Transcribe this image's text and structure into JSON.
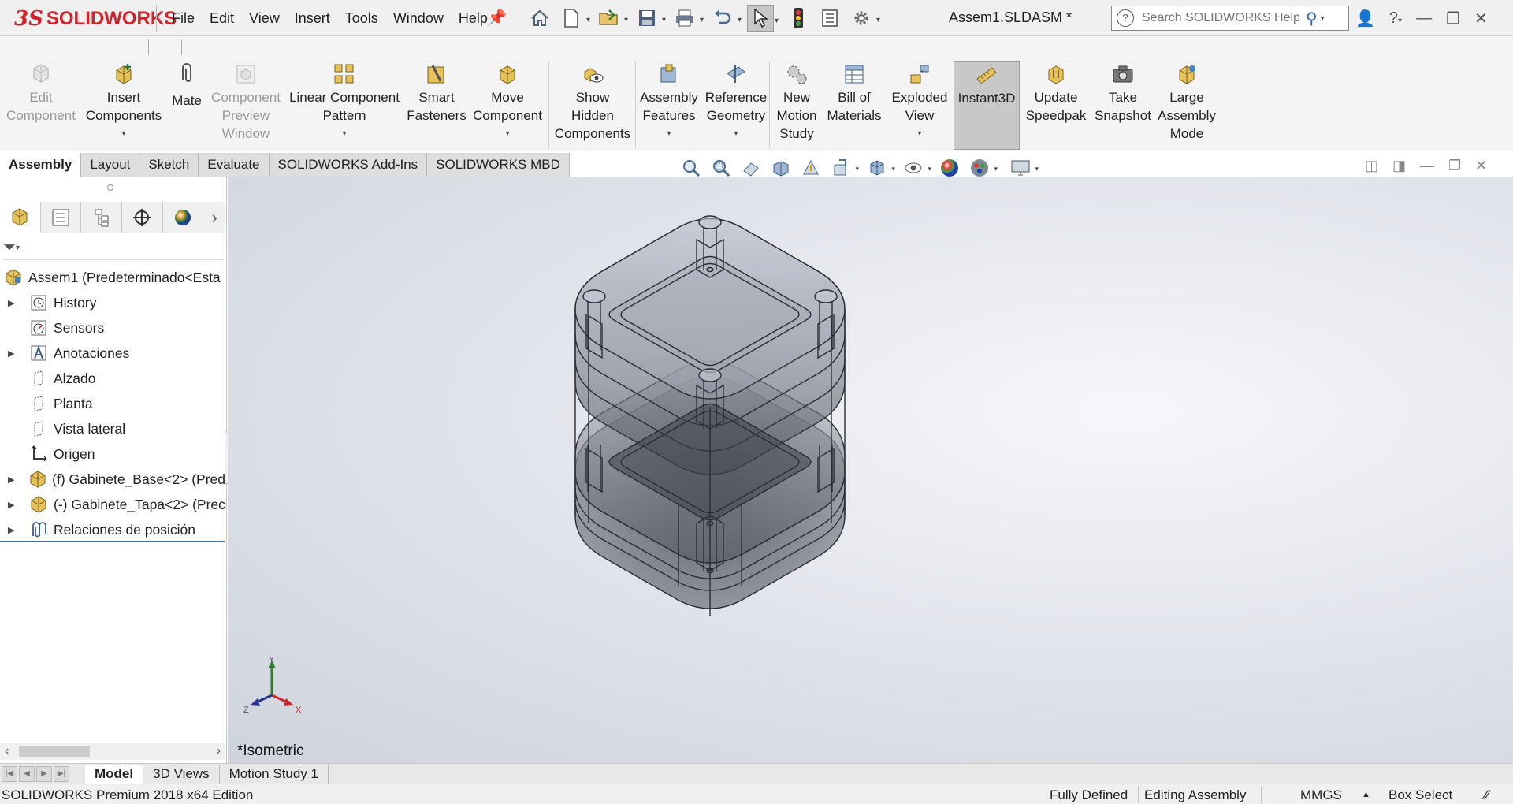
{
  "app": {
    "logo_ds": "3S",
    "logo_text": "SOLIDWORKS",
    "document_title": "Assem1.SLDASM *"
  },
  "menu": [
    "File",
    "Edit",
    "View",
    "Insert",
    "Tools",
    "Window",
    "Help"
  ],
  "quick_access": [
    {
      "name": "home-icon",
      "glyph": "⌂"
    },
    {
      "name": "new-document-icon",
      "glyph": "🗋"
    },
    {
      "name": "open-icon",
      "glyph": "📂"
    },
    {
      "name": "save-icon",
      "glyph": "💾"
    },
    {
      "name": "print-icon",
      "glyph": "🖶"
    },
    {
      "name": "undo-icon",
      "glyph": "↶"
    },
    {
      "name": "select-pointer-icon",
      "glyph": "➚"
    },
    {
      "name": "rebuild-traffic-light-icon",
      "glyph": "🚦"
    },
    {
      "name": "file-properties-icon",
      "glyph": "☰"
    },
    {
      "name": "options-gear-icon",
      "glyph": "⚙"
    }
  ],
  "search": {
    "placeholder": "Search SOLIDWORKS Help"
  },
  "ribbon": {
    "edit_component": "Edit\nComponent",
    "insert_components": "Insert\nComponents",
    "mate": "Mate",
    "component_preview": "Component\nPreview\nWindow",
    "linear_pattern": "Linear Component\nPattern",
    "smart_fasteners": "Smart\nFasteners",
    "move_component": "Move\nComponent",
    "show_hidden": "Show\nHidden\nComponents",
    "assembly_features": "Assembly\nFeatures",
    "reference_geometry": "Reference\nGeometry",
    "new_motion_study": "New\nMotion\nStudy",
    "bill_of_materials": "Bill of\nMaterials",
    "exploded_view": "Exploded\nView",
    "instant3d": "Instant3D",
    "update_speedpak": "Update\nSpeedpak",
    "take_snapshot": "Take\nSnapshot",
    "large_assembly": "Large\nAssembly\nMode"
  },
  "command_tabs": [
    "Assembly",
    "Layout",
    "Sketch",
    "Evaluate",
    "SOLIDWORKS Add-Ins",
    "SOLIDWORKS MBD"
  ],
  "tree": {
    "root": "Assem1  (Predeterminado<Esta",
    "items": [
      {
        "label": "History",
        "expandable": true
      },
      {
        "label": "Sensors",
        "expandable": false
      },
      {
        "label": "Anotaciones",
        "expandable": true
      },
      {
        "label": "Alzado",
        "expandable": false
      },
      {
        "label": "Planta",
        "expandable": false
      },
      {
        "label": "Vista lateral",
        "expandable": false
      },
      {
        "label": "Origen",
        "expandable": false
      },
      {
        "label": "(f) Gabinete_Base<2> (Pred",
        "expandable": true
      },
      {
        "label": "(-) Gabinete_Tapa<2> (Prec",
        "expandable": true
      },
      {
        "label": "Relaciones de posición",
        "expandable": true
      }
    ]
  },
  "viewport": {
    "view_name": "*Isometric",
    "triad_x": "X",
    "triad_y": "Y",
    "triad_z": "Z"
  },
  "bottom_tabs": [
    "Model",
    "3D Views",
    "Motion Study 1"
  ],
  "status": {
    "edition": "SOLIDWORKS Premium 2018 x64 Edition",
    "definition": "Fully Defined",
    "mode": "Editing Assembly",
    "units": "MMGS",
    "selection": "Box Select"
  },
  "colors": {
    "brand_red": "#d2232a",
    "tree_accent": "#3c6fb0",
    "model_edge": "#2a2d33"
  }
}
